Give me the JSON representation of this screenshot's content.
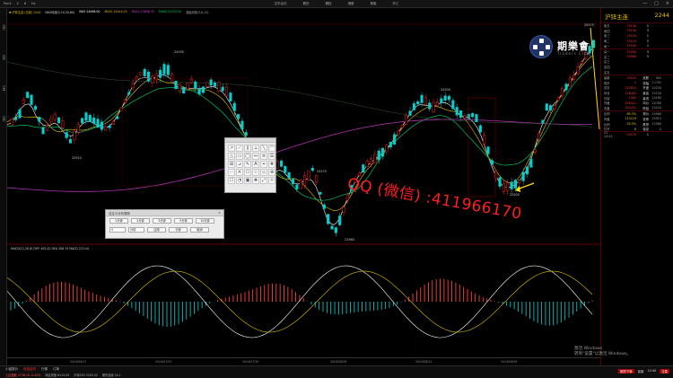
{
  "colors": {
    "up": "#ff2020",
    "down": "#00d0d0",
    "accent": "#e6c200",
    "watermark": "#ff1e1e"
  },
  "topbar": {
    "menu": [
      "Pan4",
      "4",
      "8",
      "Hz"
    ],
    "center": [
      "文华合约",
      "期货",
      "期权",
      "港股",
      "美股",
      "外汇"
    ],
    "win": [
      "—",
      "□",
      "×"
    ]
  },
  "leftbar": {
    "labels": [
      "分时",
      "K线",
      "订单",
      "日内"
    ]
  },
  "statusline": [
    {
      "text": "▼ 沪锌主连 (日线) 2244",
      "color": "#e6c200"
    },
    {
      "text": "MA5均线(5,10,20,60)",
      "color": "#dddddd"
    },
    {
      "text": "MA5 24066.00",
      "color": "#ffffff"
    },
    {
      "text": "MA10 24244.25",
      "color": "#e6c200"
    },
    {
      "text": "MA20 23698.30",
      "color": "#d040d0"
    },
    {
      "text": "MA60 23732.50",
      "color": "#00d060"
    },
    {
      "text": "涨幅均线(3,6,12)",
      "color": "#aaaaaa"
    }
  ],
  "chart_data": {
    "type": "candlestick",
    "price_labels": [
      "24195",
      "24200",
      "23270",
      "22910",
      "22500",
      "21960",
      "25575"
    ],
    "macd_header": "MACD(12,26,9)  DIFF 405.42  DEA 208.70  MACD 213.44",
    "notes": [
      "沪锌主连",
      "期货"
    ]
  },
  "right_panel": {
    "title": "沪锌主连",
    "price": "2244",
    "asks": [
      {
        "label": "卖五",
        "price": "25140",
        "vol": "2",
        "chg": ""
      },
      {
        "label": "卖四",
        "price": "25130",
        "vol": "3",
        "chg": ""
      },
      {
        "label": "卖三",
        "price": "25120",
        "vol": "1",
        "chg": ""
      },
      {
        "label": "卖二",
        "price": "25110",
        "vol": "5",
        "chg": ""
      },
      {
        "label": "卖一",
        "price": "25100",
        "vol": "1",
        "chg": ""
      }
    ],
    "bids": [
      {
        "label": "买一",
        "price": "25090",
        "vol": "3",
        "chg": ""
      },
      {
        "label": "买二",
        "price": "25080",
        "vol": "5",
        "chg": ""
      },
      {
        "label": "买三",
        "price": "",
        "vol": "",
        "chg": ""
      },
      {
        "label": "买四",
        "price": "",
        "vol": "",
        "chg": ""
      },
      {
        "label": "买五",
        "price": "",
        "vol": "",
        "chg": ""
      }
    ],
    "stats": [
      {
        "a": "最新",
        "b": "25125",
        "c": "涨跌",
        "d": "905"
      },
      {
        "a": "现手",
        "b": "3",
        "c": "涨幅",
        "d": "3.74%"
      },
      {
        "a": "总手",
        "b": "223852",
        "c": "开盘",
        "d": "24250"
      },
      {
        "a": "持仓",
        "b": "116405",
        "c": "最高",
        "d": "25140"
      },
      {
        "a": "日增",
        "b": "1085",
        "c": "最低",
        "d": "24180"
      },
      {
        "a": "外盘",
        "b": "118421",
        "c": "均价",
        "d": "24780"
      },
      {
        "a": "内盘",
        "b": "105431",
        "c": "昨结",
        "d": "24220"
      }
    ],
    "stats2": [
      {
        "a": "比例",
        "b": "69.3%",
        "c": "现价",
        "d": "24980"
      },
      {
        "a": "内盘",
        "b": "113119",
        "c": "涨停",
        "d": "25915"
      },
      {
        "a": "比例",
        "b": "50.5%",
        "c": "跌停",
        "d": "22560"
      },
      {
        "a": "杠杆",
        "b": "8",
        "c": "保证",
        "d": "0"
      }
    ],
    "ticks": [
      {
        "t": "21 15:22",
        "p": "25125",
        "v": "1"
      }
    ]
  },
  "logo": {
    "name": "期樂會",
    "sub": "Traders Club"
  },
  "watermark": "QQ (微信) :411966170",
  "tool_palette": {
    "title": "",
    "icons": [
      "↗",
      "⟋",
      "∥",
      "⟂",
      "╲",
      "⌒",
      "△",
      "▭",
      "◯",
      "↔",
      "≡",
      "☰",
      "⊞",
      "⊿",
      "✎",
      "A",
      "⌖",
      "❖",
      "⋯",
      "✕",
      "⎔",
      "☆",
      "◇",
      "⊕",
      "☐",
      "◔",
      "▣",
      "✚",
      "⤢",
      "☼"
    ]
  },
  "period_dialog": {
    "title": "自定义分析周期",
    "close": "×",
    "row1": [
      "1分钟",
      "2分钟",
      "3分钟",
      "5分钟",
      "10分钟"
    ],
    "row2_sel1": "5",
    "row2_sel2": "分钟",
    "row2_btns": [
      "应用",
      "分钟",
      "取消"
    ]
  },
  "dates": [
    "2024/06/17",
    "2024/07/03",
    "2024/07/19",
    "2024/08/06",
    "2024/08/22",
    "2024/09/09"
  ],
  "windows_watermark": {
    "line1": "激活 Windows",
    "line2": "转到\"设置\"以激活 Windows。"
  },
  "statusbar": {
    "tabs": [
      "小窗报价",
      "自选合约",
      "行情",
      "订单"
    ],
    "quotes": [
      "上证指数 2736.16 -0.00%",
      "深证成指 8119.09",
      "沪深300 3200.52",
      "期货连续 24.1"
    ],
    "right": [
      "期货下单",
      "客服",
      "10:46",
      "交易"
    ]
  }
}
